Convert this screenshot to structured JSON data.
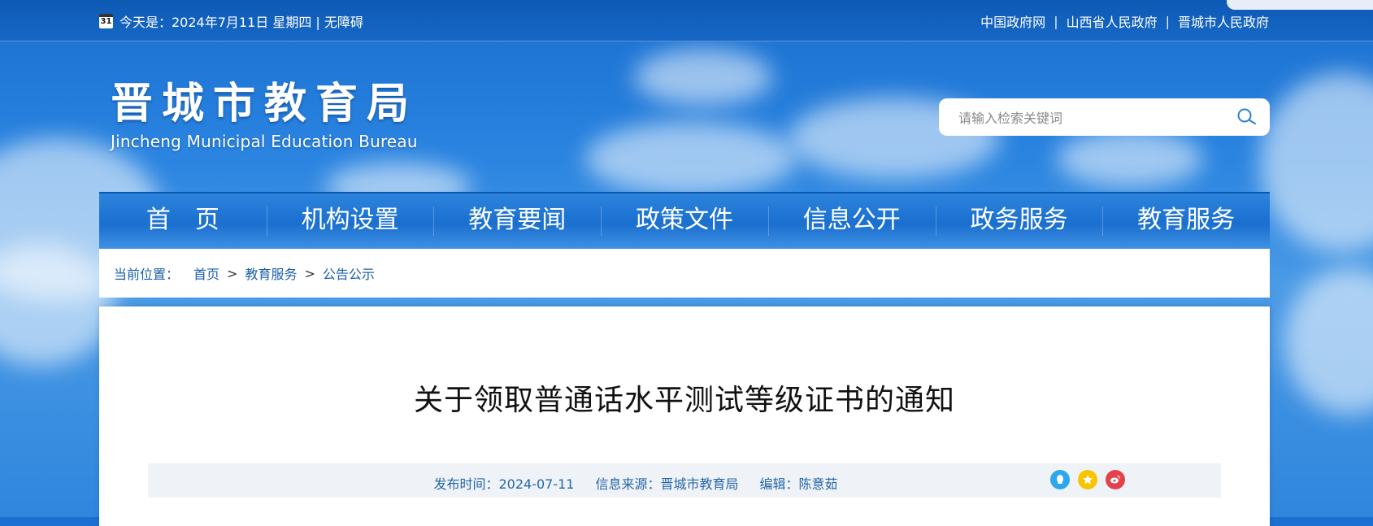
{
  "topbar": {
    "date_text": "今天是：2024年7月11日 星期四 | 无障碍",
    "calendar_day": "31",
    "links": [
      "中国政府网",
      "山西省人民政府",
      "晋城市人民政府"
    ],
    "separator": "|"
  },
  "logo": {
    "cn": "晋城市教育局",
    "en": "Jincheng Municipal Education Bureau"
  },
  "search": {
    "placeholder": "请输入检索关键词"
  },
  "nav": {
    "items": [
      "首　页",
      "机构设置",
      "教育要闻",
      "政策文件",
      "信息公开",
      "政务服务",
      "教育服务"
    ]
  },
  "breadcrumb": {
    "label": "当前位置：",
    "items": [
      "首页",
      "教育服务",
      "公告公示"
    ],
    "separator": ">"
  },
  "article": {
    "title": "关于领取普通话水平测试等级证书的通知",
    "publish_time": "发布时间：2024-07-11",
    "source": "信息来源：晋城市教育局",
    "editor": "编辑：陈意茹"
  },
  "share": {
    "icons": [
      "qq-icon",
      "qzone-icon",
      "weibo-icon"
    ],
    "colors": [
      "#2ea8ec",
      "#f6c400",
      "#e3424d"
    ]
  }
}
